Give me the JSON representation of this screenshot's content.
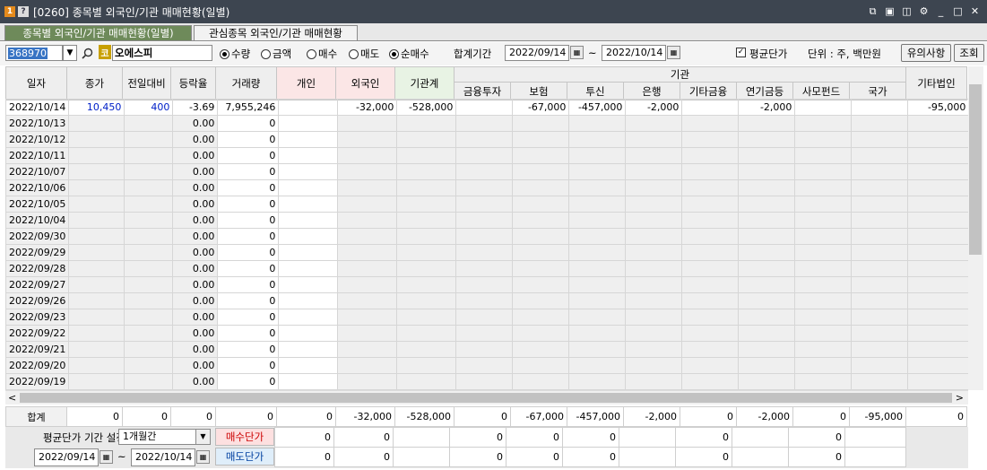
{
  "window": {
    "num": "1",
    "help": "?",
    "title": "[0260] 종목별 외국인/기관 매매현황(일별)"
  },
  "tabs": [
    {
      "label": "종목별 외국인/기관 매매현황(일별)"
    },
    {
      "label": "관심종목 외국인/기관 매매현황"
    }
  ],
  "search": {
    "code": "368970",
    "market_badge": "코",
    "name": "오에스피"
  },
  "radios": {
    "qty": "수량",
    "amount": "금액",
    "buy": "매수",
    "sell": "매도",
    "net": "순매수"
  },
  "period": {
    "label": "합계기간",
    "from": "2022/09/14",
    "sep": "~",
    "to": "2022/10/14"
  },
  "avg_price": {
    "label": "평균단가",
    "checked": true
  },
  "unit": {
    "label": "단위 : 주, 백만원"
  },
  "buttons": {
    "caution": "유의사항",
    "query": "조회"
  },
  "headers": {
    "date": "일자",
    "close": "종가",
    "change": "전일대비",
    "rate": "등락율",
    "volume": "거래량",
    "individual": "개인",
    "foreign": "외국인",
    "inst_total": "기관계",
    "inst_group": "기관",
    "fin_invest": "금융투자",
    "insurance": "보험",
    "trust": "투신",
    "bank": "은행",
    "other_fin": "기타금융",
    "pension": "연기금등",
    "private_fund": "사모펀드",
    "nation": "국가",
    "other_corp": "기타법인"
  },
  "rows": [
    {
      "date": "2022/10/14",
      "close": "10,450",
      "change": "400",
      "rate": "-3.69",
      "volume": "7,955,246",
      "individual": "",
      "foreign": "-32,000",
      "inst_total": "-528,000",
      "fin_invest": "",
      "insurance": "-67,000",
      "trust": "-457,000",
      "bank": "-2,000",
      "other_fin": "",
      "pension": "-2,000",
      "private_fund": "",
      "nation": "",
      "other_corp": "-95,000"
    },
    {
      "date": "2022/10/13",
      "rate": "0.00",
      "volume": "0"
    },
    {
      "date": "2022/10/12",
      "rate": "0.00",
      "volume": "0"
    },
    {
      "date": "2022/10/11",
      "rate": "0.00",
      "volume": "0"
    },
    {
      "date": "2022/10/07",
      "rate": "0.00",
      "volume": "0"
    },
    {
      "date": "2022/10/06",
      "rate": "0.00",
      "volume": "0"
    },
    {
      "date": "2022/10/05",
      "rate": "0.00",
      "volume": "0"
    },
    {
      "date": "2022/10/04",
      "rate": "0.00",
      "volume": "0"
    },
    {
      "date": "2022/09/30",
      "rate": "0.00",
      "volume": "0"
    },
    {
      "date": "2022/09/29",
      "rate": "0.00",
      "volume": "0"
    },
    {
      "date": "2022/09/28",
      "rate": "0.00",
      "volume": "0"
    },
    {
      "date": "2022/09/27",
      "rate": "0.00",
      "volume": "0"
    },
    {
      "date": "2022/09/26",
      "rate": "0.00",
      "volume": "0"
    },
    {
      "date": "2022/09/23",
      "rate": "0.00",
      "volume": "0"
    },
    {
      "date": "2022/09/22",
      "rate": "0.00",
      "volume": "0"
    },
    {
      "date": "2022/09/21",
      "rate": "0.00",
      "volume": "0"
    },
    {
      "date": "2022/09/20",
      "rate": "0.00",
      "volume": "0"
    },
    {
      "date": "2022/09/19",
      "rate": "0.00",
      "volume": "0"
    }
  ],
  "sum": {
    "label": "합계",
    "close": "0",
    "change": "0",
    "rate": "0",
    "volume": "0",
    "individual": "0",
    "foreign": "-32,000",
    "inst_total": "-528,000",
    "fin_invest": "0",
    "insurance": "-67,000",
    "trust": "-457,000",
    "bank": "-2,000",
    "other_fin": "0",
    "pension": "-2,000",
    "private_fund": "0",
    "nation": "-95,000",
    "other_corp": "0"
  },
  "footer": {
    "avg_period_label": "평균단가 기간 설정",
    "period_select": "1개월간",
    "from": "2022/09/14",
    "sep": "~",
    "to": "2022/10/14",
    "buy_label": "매수단가",
    "sell_label": "매도단가",
    "buy_vals": [
      "0",
      "0",
      "0",
      "0",
      "0",
      "0",
      "0"
    ],
    "sell_vals": [
      "0",
      "0",
      "0",
      "0",
      "0",
      "0",
      "0"
    ]
  }
}
